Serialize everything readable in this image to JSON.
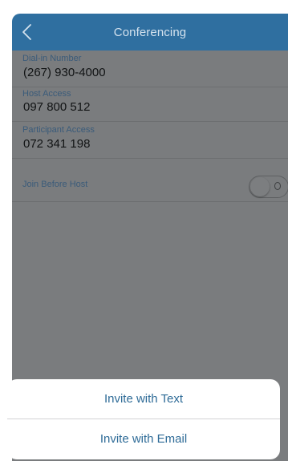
{
  "nav": {
    "title": "Conferencing",
    "back_icon": "chevron-left-icon"
  },
  "fields": [
    {
      "label": "Dial-in Number",
      "value": "(267) 930-4000"
    },
    {
      "label": "Host Access",
      "value": "097 800 512"
    },
    {
      "label": "Participant Access",
      "value": "072 341 198"
    }
  ],
  "join_before_host": {
    "label": "Join Before Host",
    "enabled": false
  },
  "action_sheet": {
    "invite_text": "Invite with Text",
    "invite_email": "Invite with Email"
  },
  "colors": {
    "nav_background": "#2f6fa0",
    "accent_text": "#2e6b97",
    "dim_overlay": "#7a7c7e"
  }
}
